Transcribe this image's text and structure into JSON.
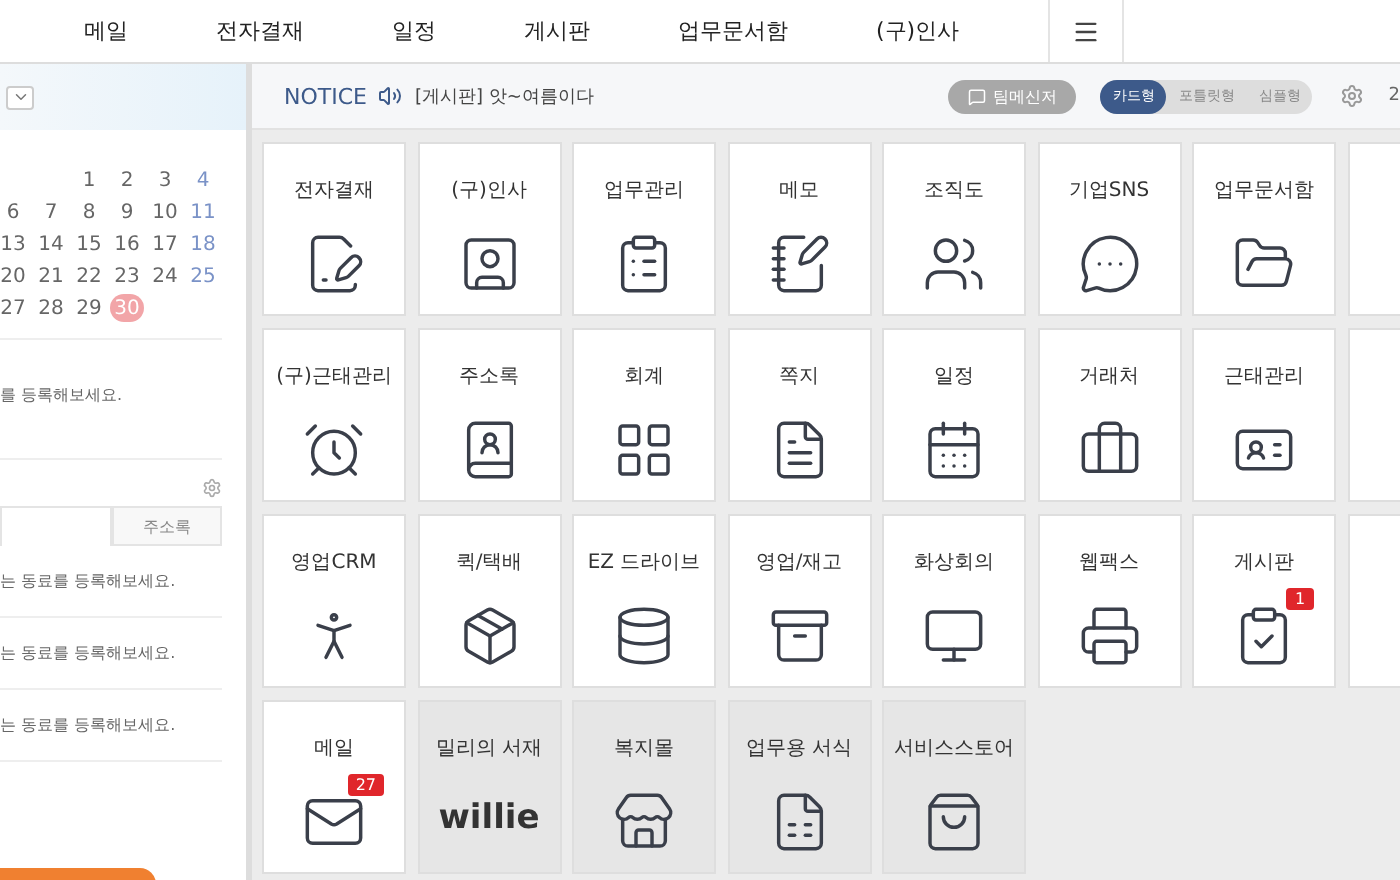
{
  "nav": {
    "items": [
      "메일",
      "전자결재",
      "일정",
      "게시판",
      "업무문서함",
      "(구)인사"
    ]
  },
  "sidebar": {
    "calendar": {
      "weeks": [
        [
          {
            "day": "1",
            "selected": false
          },
          {
            "day": "2",
            "selected": false
          },
          {
            "day": "3",
            "selected": false
          },
          {
            "day": "4",
            "selected": false
          }
        ],
        [
          {
            "day": "6",
            "selected": false
          },
          {
            "day": "7",
            "selected": false
          },
          {
            "day": "8",
            "selected": false
          },
          {
            "day": "9",
            "selected": false
          },
          {
            "day": "10",
            "selected": false
          },
          {
            "day": "11",
            "selected": false
          }
        ],
        [
          {
            "day": "13",
            "selected": false
          },
          {
            "day": "14",
            "selected": false
          },
          {
            "day": "15",
            "selected": false
          },
          {
            "day": "16",
            "selected": false
          },
          {
            "day": "17",
            "selected": false
          },
          {
            "day": "18",
            "selected": false
          }
        ],
        [
          {
            "day": "20",
            "selected": false
          },
          {
            "day": "21",
            "selected": false
          },
          {
            "day": "22",
            "selected": false
          },
          {
            "day": "23",
            "selected": false
          },
          {
            "day": "24",
            "selected": false
          },
          {
            "day": "25",
            "selected": false
          }
        ],
        [
          {
            "day": "27",
            "selected": false
          },
          {
            "day": "28",
            "selected": false
          },
          {
            "day": "29",
            "selected": false
          },
          {
            "day": "30",
            "selected": true
          }
        ]
      ]
    },
    "schedule_hint": "를 등록해보세요.",
    "tabs": [
      {
        "selected": true
      },
      {
        "label": "주소록",
        "selected": false
      }
    ],
    "contacts": [
      "는 동료를 등록해보세요.",
      "는 동료를 등록해보세요.",
      "는 동료를 등록해보세요."
    ]
  },
  "notice": {
    "label": "NOTICE",
    "text": "[게시판] 앗~여름이다"
  },
  "messenger_button": "팀메신저",
  "view_modes": [
    {
      "label": "카드형",
      "selected": true
    },
    {
      "label": "포틀릿형",
      "selected": false
    },
    {
      "label": "심플형",
      "selected": false
    }
  ],
  "edge_text": "2",
  "tiles": [
    {
      "label": "전자결재",
      "disabled": false
    },
    {
      "label": "(구)인사",
      "disabled": false
    },
    {
      "label": "업무관리",
      "disabled": false
    },
    {
      "label": "메모",
      "disabled": false
    },
    {
      "label": "조직도",
      "disabled": false
    },
    {
      "label": "기업SNS",
      "disabled": false
    },
    {
      "label": "업무문서함",
      "disabled": false
    },
    {
      "disabled": false
    },
    {
      "label": "(구)근태관리",
      "disabled": false
    },
    {
      "label": "주소록",
      "disabled": false
    },
    {
      "label": "회계",
      "disabled": false
    },
    {
      "label": "쪽지",
      "disabled": false
    },
    {
      "label": "일정",
      "disabled": false
    },
    {
      "label": "거래처",
      "disabled": false
    },
    {
      "label": "근태관리",
      "disabled": false
    },
    {
      "disabled": false
    },
    {
      "label": "영업CRM",
      "disabled": false
    },
    {
      "label": "퀵/택배",
      "disabled": false
    },
    {
      "label": "EZ 드라이브",
      "disabled": false
    },
    {
      "label": "영업/재고",
      "disabled": false
    },
    {
      "label": "화상회의",
      "disabled": false
    },
    {
      "label": "웹팩스",
      "disabled": false
    },
    {
      "label": "게시판",
      "disabled": false,
      "badge": "1"
    },
    {
      "disabled": false
    },
    {
      "label": "메일",
      "disabled": false,
      "badge": "27"
    },
    {
      "label": "밀리의 서재",
      "disabled": true,
      "logo_text": "willie"
    },
    {
      "label": "복지몰",
      "disabled": true
    },
    {
      "label": "업무용 서식",
      "disabled": true
    },
    {
      "label": "서비스스토어",
      "disabled": true
    }
  ]
}
